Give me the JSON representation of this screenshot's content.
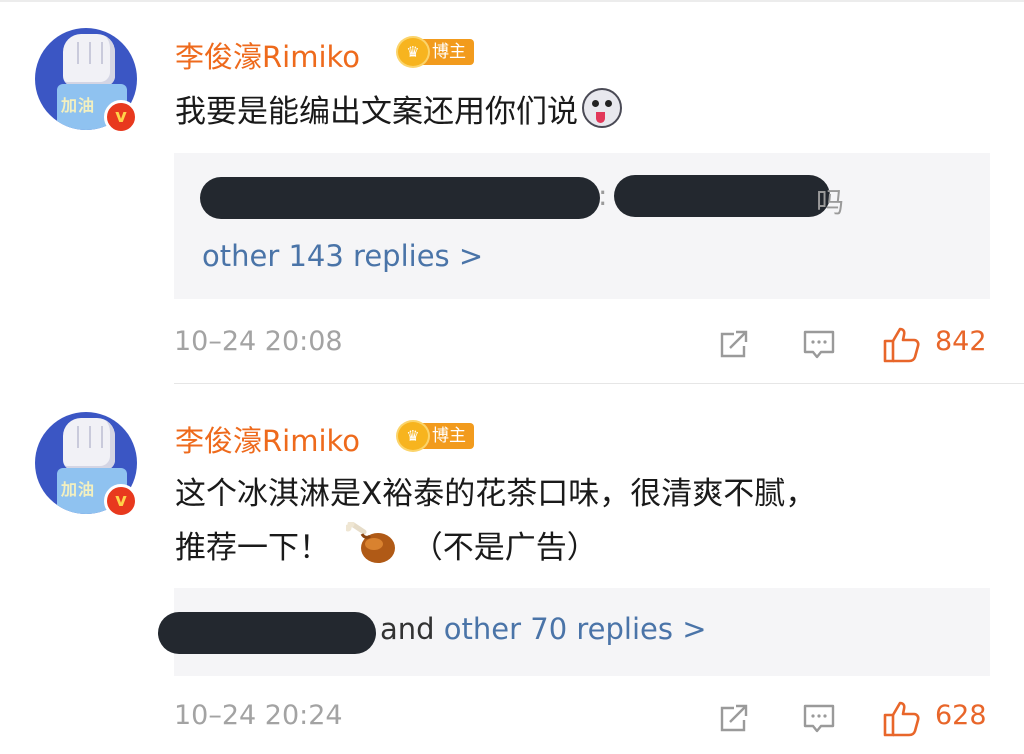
{
  "comments": [
    {
      "username": "李俊濠Rimiko",
      "badge": "博主",
      "avatar_text": "加油",
      "verified_mark": "v",
      "text": "我要是能编出文案还用你们说",
      "emoji": "husky-face-emoji",
      "reply_more": "other 143 replies >",
      "reply_separator": ":",
      "reply_tail": "吗",
      "time": "10–24 20:08",
      "likes": "842"
    },
    {
      "username": "李俊濠Rimiko",
      "badge": "博主",
      "avatar_text": "加油",
      "verified_mark": "v",
      "text_line1": "这个冰淇淋是X裕泰的花茶口味，很清爽不腻，",
      "text_line2_a": "推荐一下！",
      "emoji": "drumstick-emoji",
      "text_line2_b": "（不是广告）",
      "reply_and": "and",
      "reply_more": "other 70 replies >",
      "time": "10–24 20:24",
      "likes": "628"
    }
  ],
  "colors": {
    "username": "#ee6a1c",
    "badge": "#f29b1d",
    "link": "#4a74a8",
    "like": "#e8662a",
    "meta": "#a3a3a3"
  },
  "icons": [
    "share-icon",
    "comment-icon",
    "like-icon"
  ]
}
